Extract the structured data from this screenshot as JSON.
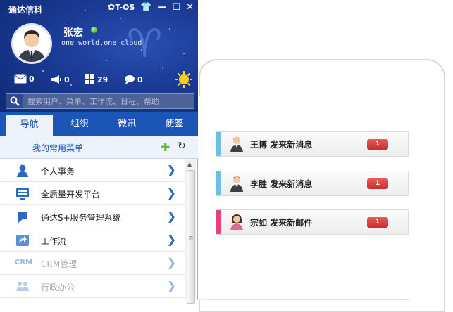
{
  "app": {
    "title": "通达信科"
  },
  "titlebar": {
    "tos_label": "T-OS"
  },
  "user": {
    "name": "张宏",
    "motto": "one world,one cloud"
  },
  "stats": {
    "mail": "0",
    "broadcast": "0",
    "apps": "29",
    "chat": "0"
  },
  "search": {
    "placeholder": "搜索用户、菜单、工作流、日程、帮助"
  },
  "tabs": [
    {
      "label": "导航",
      "active": true
    },
    {
      "label": "组织"
    },
    {
      "label": "微讯"
    },
    {
      "label": "便签"
    }
  ],
  "favorites": {
    "title": "我的常用菜单"
  },
  "menu": [
    {
      "label": "个人事务",
      "icon": "person-icon"
    },
    {
      "label": "全质量开发平台",
      "icon": "monitor-icon"
    },
    {
      "label": "通达S+服务管理系统",
      "icon": "flag-icon"
    },
    {
      "label": "工作流",
      "icon": "workflow-icon"
    },
    {
      "label": "CRM管理",
      "icon": "crm-icon"
    },
    {
      "label": "行政办公",
      "icon": "group-icon"
    }
  ],
  "crm_icon_text": "CRM",
  "notifications": [
    {
      "sender": "王博",
      "text": "发来新消息",
      "count": "1",
      "color": "#6cc0e5",
      "avatar": "male-avatar-icon"
    },
    {
      "sender": "李胜",
      "text": "发来新消息",
      "count": "1",
      "color": "#6cc0e5",
      "avatar": "male-avatar-icon"
    },
    {
      "sender": "宗如",
      "text": "发来新邮件",
      "count": "1",
      "color": "#e8427a",
      "avatar": "female-avatar-icon"
    }
  ]
}
